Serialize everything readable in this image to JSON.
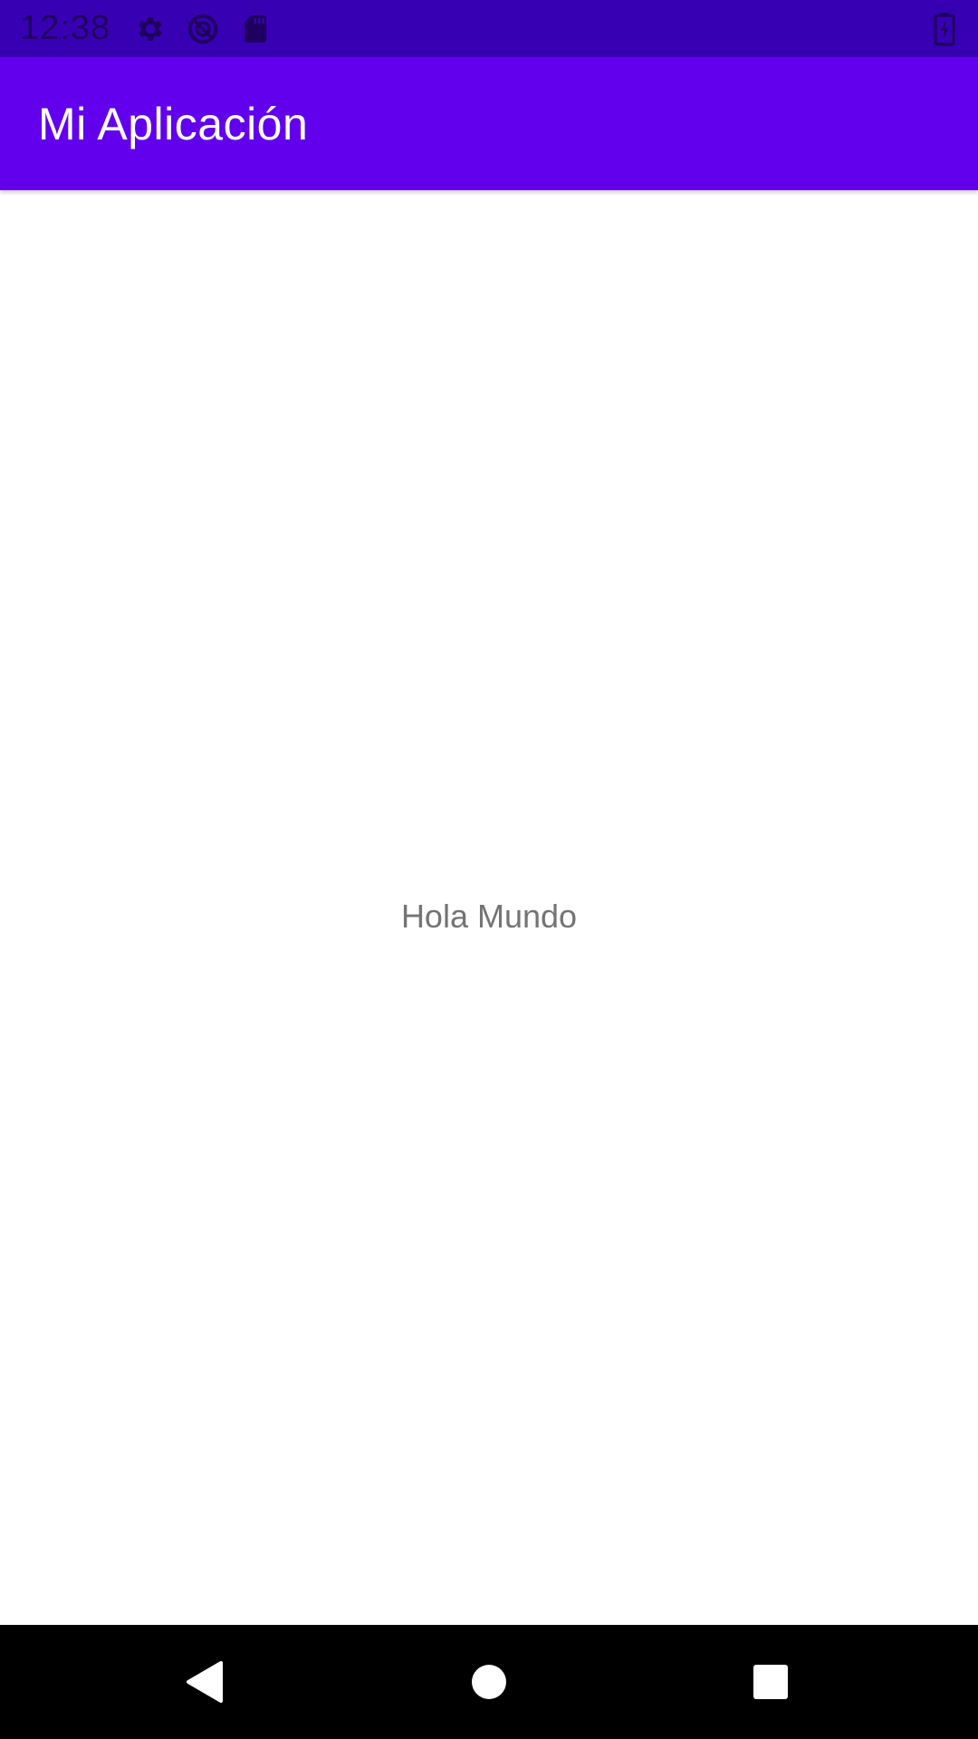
{
  "status_bar": {
    "time": "12:38",
    "icons": [
      "gear-icon",
      "no-disturb-icon",
      "sd-card-icon",
      "battery-charging-icon"
    ],
    "background": "#3700b3"
  },
  "app_bar": {
    "title": "Mi Aplicación",
    "background": "#6200ee"
  },
  "content": {
    "text": "Hola Mundo"
  },
  "nav_bar": {
    "buttons": [
      "back-icon",
      "home-icon",
      "recents-icon"
    ]
  }
}
